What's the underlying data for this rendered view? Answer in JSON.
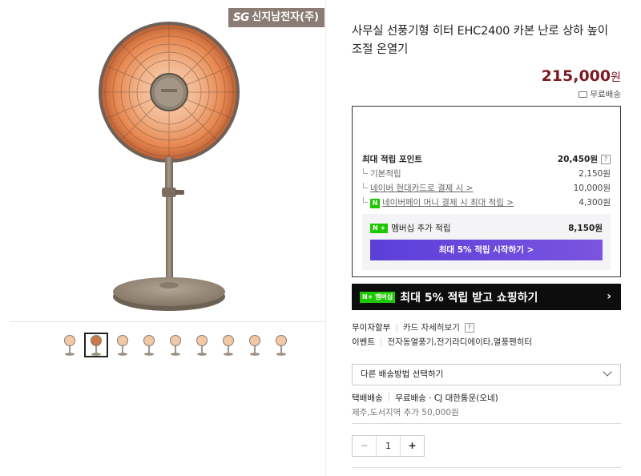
{
  "brand_badge": {
    "logo": "SG",
    "name": "신지남전자(주)"
  },
  "product": {
    "title": "사무실 선풍기형 히터 EHC2400 카본 난로 상하 높이 조절 온열기",
    "price": "215,000",
    "price_unit": "원",
    "shipping_tag": "무료배송"
  },
  "thumbnails_count": 9,
  "points": {
    "max_label": "최대 적립 포인트",
    "max_value": "20,450원",
    "help": "?",
    "rows": [
      {
        "label": "기본적립",
        "value": "2,150원"
      },
      {
        "label": "네이버 현대카드로 결제 시 >",
        "value": "10,000원"
      },
      {
        "label": "네이버페이 머니 결제 시 최대 적립 >",
        "value": "4,300원"
      }
    ],
    "member_label": "멤버십 추가 적립",
    "member_value": "8,150원",
    "member_cta": "최대 5% 적립 시작하기 >"
  },
  "banner": {
    "badge": "N+ 멤버십",
    "text": "최대 5% 적립 받고 쇼핑하기",
    "arrow": "›"
  },
  "installment": {
    "label": "무이자할부",
    "link": "카드 자세히보기",
    "help": "?"
  },
  "event": {
    "label": "이벤트",
    "text": "전자동열풍기,전기라디에이타,열풍펜히터"
  },
  "shipping_select": {
    "value": "다른 배송방법 선택하기"
  },
  "delivery": {
    "type": "택배배송",
    "detail": "무료배송 · CJ 대한통운(오네)",
    "extra": "제주,도서지역 추가 50,000원"
  },
  "quantity": {
    "minus": "−",
    "value": "1",
    "plus": "+"
  },
  "colors": {
    "price": "#7a1a21",
    "npay_green": "#1ec800",
    "cta_purple": "#6a4ad9",
    "brand_badge": "#8a7c74"
  }
}
